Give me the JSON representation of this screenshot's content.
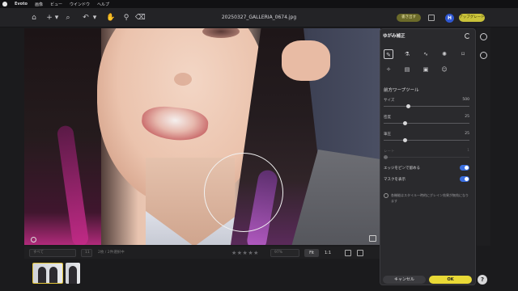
{
  "menubar": {
    "app_name": "Evoto",
    "items": [
      "画像",
      "ビュー",
      "ウインドウ",
      "ヘルプ"
    ]
  },
  "toolbar": {
    "document_title": "20250327_GALLERIA_0674.jpg",
    "export_label": "書き出す",
    "avatar_initial": "H",
    "upgrade_label": "アップグレード",
    "icons": [
      "home-icon",
      "add-icon",
      "search-icon",
      "undo-icon",
      "hand-icon",
      "dropper-icon",
      "eraser-icon"
    ]
  },
  "panel": {
    "title": "ゆがみ補正",
    "tool_icons": [
      "forward-warp-icon",
      "reconstruct-icon",
      "smooth-icon",
      "twirl-icon",
      "pucker-icon",
      "bloat-icon",
      "freeze-icon",
      "thaw-icon",
      "face-icon"
    ],
    "section_title": "前方ワープツール",
    "sliders": [
      {
        "label": "サイズ",
        "value": "500",
        "fraction": 0.3
      },
      {
        "label": "密度",
        "value": "25",
        "fraction": 0.25
      },
      {
        "label": "筆圧",
        "value": "25",
        "fraction": 0.25
      },
      {
        "label": "レート",
        "value": "1",
        "fraction": 0.0,
        "disabled": true
      }
    ],
    "toggles": [
      {
        "label": "エッジをピンで留める",
        "on": true
      },
      {
        "label": "マスクを表示",
        "on": true
      }
    ],
    "note": "各機能はスタイル一時的にグレイン効果が無効になります",
    "cancel_label": "キャンセル",
    "ok_label": "OK"
  },
  "filmstrip": {
    "filter_value": "すべて",
    "count_value": "11",
    "selection_text": "2枚 / 2件選択中",
    "zoom_percent": "97%",
    "fit_label": "Fit",
    "one_to_one_label": "1:1",
    "rating_stars": "★★★★★"
  },
  "colors": {
    "accent_yellow": "#e9d936",
    "toggle_blue": "#3b6fe0",
    "avatar_blue": "#2f57d1"
  }
}
